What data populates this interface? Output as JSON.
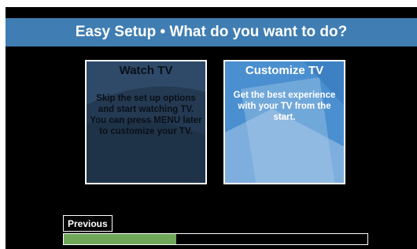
{
  "header": {
    "title": "Easy Setup • What do you want to do?"
  },
  "options": [
    {
      "title": "Watch TV",
      "description": "Skip the set up options and start watching TV. You can press MENU later to customize your TV."
    },
    {
      "title": "Customize TV",
      "description": "Get the best experience with your TV from the start."
    }
  ],
  "navigation": {
    "previous_label": "Previous"
  },
  "progress": {
    "fraction": 0.37
  },
  "colors": {
    "title_bar": "#3f7db3",
    "selected_tile": "#4a8fd0",
    "unselected_tile": "#243a52",
    "progress_fill": "#70a85a"
  }
}
